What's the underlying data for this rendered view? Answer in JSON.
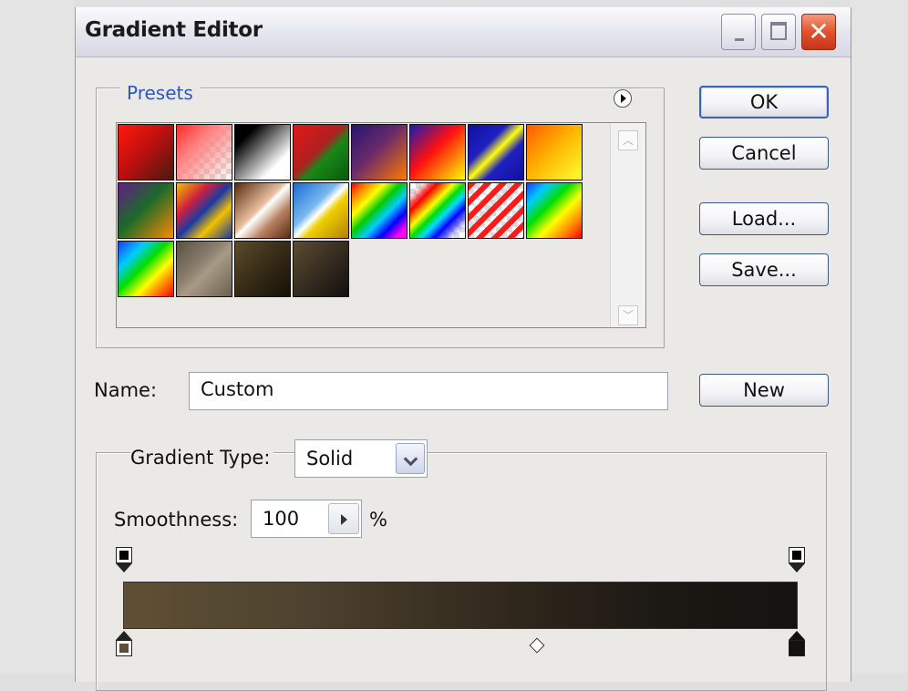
{
  "window": {
    "title": "Gradient Editor",
    "controls": [
      "minimize-icon",
      "maximize-icon",
      "close-icon"
    ],
    "close_glyph": "✕"
  },
  "presets": {
    "label": "Presets",
    "menu_icon": "flyout-menu-icon",
    "swatches": [
      "linear-gradient(135deg,#ff1a0a 0%,#c01010 45%,#4a1a10 100%)",
      "linear-gradient(135deg,#ff2a2a 0%,#ff8080 35%,rgba(255,255,255,0.0) 100%),repeating-conic-gradient(#dcdcdc 0 25%,#ffffff 0 50%) 0 0/12px 12px",
      "linear-gradient(135deg,#000 0%,#000 20%,#ffffff 75%,#ffffff 100%)",
      "linear-gradient(135deg,#e01818 0%,#b02020 45%,#188818 60%,#0a5a0a 100%)",
      "linear-gradient(135deg,#261470 0%,#6a2a6a 45%,#ff7a00 100%)",
      "linear-gradient(135deg,#1a1ab0 0%,#ff1010 45%,#ffff00 100%)",
      "linear-gradient(135deg,#1010a0 0%,#2020c0 35%,#ffff10 50%,#2020c0 65%,#1010a0 100%)",
      "linear-gradient(135deg,#ff5a00 0%,#ffb000 45%,#ffff30 100%)",
      "linear-gradient(135deg,#6a1a8a 0%,#1a6a2a 45%,#ff8a00 100%)",
      "linear-gradient(135deg,#f2c000 0%,#d02040 30%,#1a3aa0 50%,#f2c000 70%,#1a3aa0 100%)",
      "linear-gradient(135deg,#5a2a10 0%,#e8c0a0 45%,#ffffff 50%,#b88060 70%,#5a2a10 100%)",
      "linear-gradient(135deg,#1a6ad0 0%,#7ab8f0 40%,#ffffff 50%,#f0d000 60%,#b08000 100%)",
      "linear-gradient(135deg,#ff0000 0%,#ff8800 15%,#ffff00 30%,#00cc00 45%,#00ccff 60%,#0000ff 75%,#ff00ff 90%)",
      "linear-gradient(135deg,rgba(255,0,0,0) 10%,#ff0000 25%,#ffff00 40%,#00dd00 50%,#00ddff 60%,#0000ff 72%,rgba(255,0,255,0) 90%),repeating-conic-gradient(#dcdcdc 0 25%,#ffffff 0 50%) 0 0/12px 12px",
      "repeating-linear-gradient(135deg,#ff1a1a 0 6px,rgba(255,255,255,0.0) 6px 12px),repeating-conic-gradient(#dcdcdc 0 25%,#ffffff 0 50%) 0 0/12px 12px",
      "linear-gradient(135deg,#1a3aff 0%,#00ccff 20%,#00dd00 40%,#ffff00 60%,#ff8800 80%,#ff0000 100%)",
      "linear-gradient(135deg,#1a3aff 0%,#00ccff 25%,#00dd00 45%,#ffff00 65%,#ff8800 80%,#ff0000 100%)",
      "linear-gradient(135deg,#5a5044 0%,#8a7e6c 40%,#a89a86 55%,#6a6050 100%)",
      "linear-gradient(135deg,#5c4c2a 0%,#3a2e18 45%,#151008 100%)",
      "linear-gradient(135deg,#5c4c32 0%,#3a3022 45%,#121010 100%)"
    ],
    "scroll_up_icon": "scroll-up-arrow-icon",
    "scroll_down_icon": "scroll-down-arrow-icon",
    "scroll_up_glyph": "︿",
    "scroll_down_glyph": "﹀"
  },
  "buttons": {
    "ok": "OK",
    "cancel": "Cancel",
    "load": "Load...",
    "save": "Save...",
    "new": "New"
  },
  "name": {
    "label": "Name:",
    "value": "Custom"
  },
  "gradient": {
    "type_label": "Gradient Type:",
    "type_value": "Solid",
    "smoothness_label": "Smoothness:",
    "smoothness_value": "100",
    "percent": "%",
    "color_stops": [
      "#5f4f34",
      "#151310"
    ],
    "opacity_stops": [
      "#000000",
      "#000000"
    ]
  }
}
